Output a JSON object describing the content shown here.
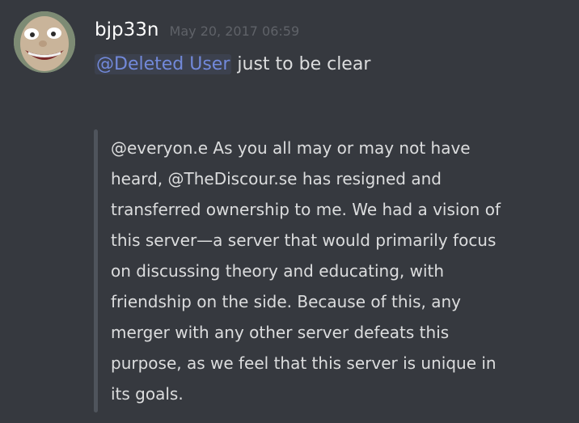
{
  "message": {
    "username": "bjp33n",
    "timestamp": "May 20, 2017 06:59",
    "mention": "@Deleted User",
    "text": "just to be clear",
    "quote_lines": [
      "@everyon.e As you all may or may not have",
      "heard, @TheDiscour.se has resigned and",
      "transferred ownership to me. We had a vision of",
      "this server—a server that would primarily focus",
      "on discussing theory and educating, with",
      "friendship on the side. Because of this, any",
      "merger with any other server defeats this",
      "purpose, as we feel that this server is unique in",
      "its goals."
    ]
  },
  "colors": {
    "background": "#36393f",
    "username": "#ffffff",
    "timestamp": "#5f6268",
    "mention": "#7289da",
    "text": "#dcddde",
    "quote_bar": "#4f545c"
  },
  "icons": {
    "avatar": "user-avatar-photo"
  }
}
